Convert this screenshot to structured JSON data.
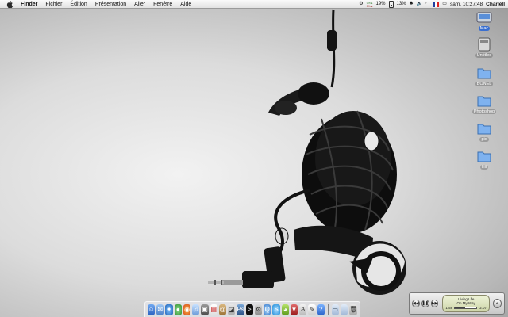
{
  "menubar": {
    "items": [
      "Finder",
      "Fichier",
      "Édition",
      "Présentation",
      "Aller",
      "Fenêtre",
      "Aide"
    ],
    "stats": [
      "0% ▸",
      "0% ▸"
    ],
    "battery_percent_1": "19%",
    "battery_percent_2": "13%",
    "clock": "sam. 10:27:48",
    "user": "Charlèll"
  },
  "desktop_icons": [
    {
      "label": "Mac",
      "selected": true
    },
    {
      "label": "Untitled",
      "selected": false
    },
    {
      "label": "BONEL",
      "selected": false
    },
    {
      "label": "Photoshop",
      "selected": false
    },
    {
      "label": "pix",
      "selected": false
    },
    {
      "label": "lllll",
      "selected": false
    }
  ],
  "dock": {
    "apps": [
      "finder-icon",
      "mail-icon",
      "safari-icon",
      "ichat-icon",
      "firefox-icon",
      "itunes-icon",
      "iphoto-icon",
      "ical-icon",
      "address-book-icon",
      "preview-icon",
      "photoshop-icon",
      "terminal-icon",
      "system-preferences-icon",
      "quicktime-icon",
      "skype-icon",
      "adium-icon",
      "transmission-icon",
      "dictionary-icon",
      "textedit-icon",
      "sherlock-icon"
    ],
    "right_items": [
      "documents-stack-icon",
      "downloads-stack-icon",
      "trash-icon"
    ]
  },
  "itunes": {
    "line1": "Living Life",
    "line2": "On My Way",
    "elapsed": "1:58",
    "remaining": "-2:07",
    "progress": 0.49
  },
  "colors": {
    "selection": "#3a6fd0",
    "folder": "#7fb2ef"
  }
}
